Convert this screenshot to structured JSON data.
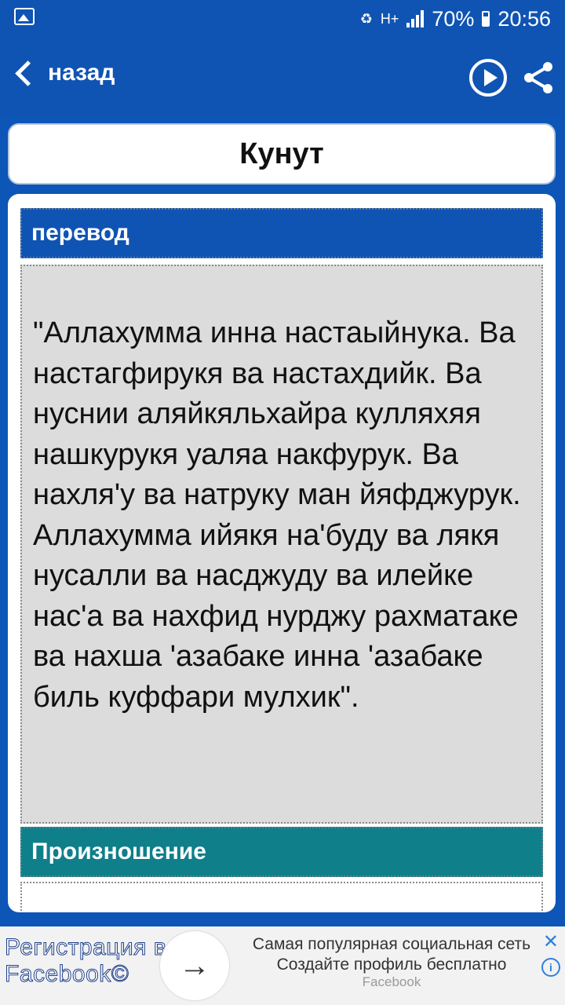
{
  "status_bar": {
    "network": "H+",
    "battery": "70%",
    "time": "20:56"
  },
  "appbar": {
    "back_label": "назад"
  },
  "title": "Кунут",
  "translation_section": {
    "heading": "перевод",
    "text": "\"Аллахумма инна настаыйнука. Ва настагфирукя ва настахдийк. Ва нуснии аляйкяльхайра кулляхяя нашкурукя уаляа накфурук. Ва нахля'у ва натруку ман йяфджурук. Аллахумма ийякя на'буду ва лякя нусалли ва насджуду ва илейке нас'а ва нахфид нурджу рахматаке ва нахша 'азабаке инна 'азабаке биль куффари мулхик\"."
  },
  "pronunciation_section": {
    "heading": "Произношение"
  },
  "ad": {
    "left_text": "Регистрация в Facebook©",
    "arrow": "→",
    "text": "Самая популярная социальная сеть Создайте профиль бесплатно",
    "source": "Facebook",
    "close": "✕",
    "info": "i"
  },
  "colors": {
    "primary_blue": "#0f54b3",
    "teal": "#0f7f8a",
    "text_box_gray": "#dcdcdc"
  },
  "icons": [
    "gallery-icon",
    "battery-saver-icon",
    "signal-icon",
    "battery-icon",
    "back-chevron-icon",
    "play-icon",
    "share-icon",
    "arrow-right-icon",
    "close-icon",
    "info-icon"
  ]
}
